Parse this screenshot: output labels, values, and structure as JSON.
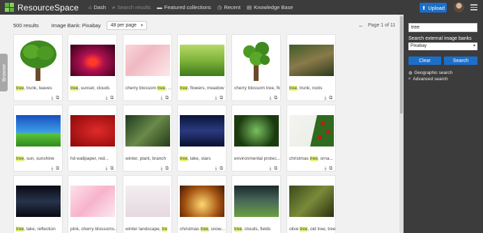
{
  "header": {
    "brand": "ResourceSpace",
    "nav": [
      {
        "icon": "home-icon",
        "glyph": "⌂",
        "label": "Dash",
        "muted": false
      },
      {
        "icon": "search-icon",
        "glyph": "⌕",
        "label": "Search results",
        "muted": true
      },
      {
        "icon": "folder-icon",
        "glyph": "▬",
        "label": "Featured collections",
        "muted": false
      },
      {
        "icon": "clock-icon",
        "glyph": "◷",
        "label": "Recent",
        "muted": false
      },
      {
        "icon": "book-icon",
        "glyph": "▤",
        "label": "Knowledge Base",
        "muted": false
      }
    ],
    "upload_label": "Upload"
  },
  "toolbar": {
    "results": "500 results",
    "bank": "Image Bank: Pixabay",
    "per_page": "48 per page",
    "pager": "Page 1 of 11"
  },
  "browse_tab": "Browse",
  "sidebar": {
    "search_value": "tree",
    "external_label": "Search external image banks",
    "external_selected": "Pixabay",
    "clear_label": "Clear",
    "search_label": "Search",
    "links": [
      {
        "icon": "globe-icon",
        "glyph": "◍",
        "label": "Geographic search"
      },
      {
        "icon": "magnifier-icon",
        "glyph": "⌕",
        "label": "Advanced search"
      }
    ]
  },
  "cards": [
    {
      "pre": "",
      "hl": "tree",
      "post": ", trunk, leaves",
      "bg": "linear-gradient(#fff,#fff)",
      "art": "tree1"
    },
    {
      "pre": "",
      "hl": "tree",
      "post": ", sunset, clouds",
      "bg": "radial-gradient(ellipse at 50% 55%, #ff3a2a 0 12%, #b01050 35%, #300018 100%)",
      "art": "none"
    },
    {
      "pre": "cherry blossom ",
      "hl": "tree",
      "post": ", ...",
      "bg": "linear-gradient(135deg,#f7d6da,#f1b9c2 40%,#fbe9ea)",
      "art": "none"
    },
    {
      "pre": "",
      "hl": "tree",
      "post": ", flowers, meadow",
      "bg": "linear-gradient(#b6d86a,#7fb33a 50%,#3f7a1e)",
      "art": "none"
    },
    {
      "pre": "cherry blossom tree, flow...",
      "hl": "",
      "post": "",
      "bg": "linear-gradient(#fff,#fff)",
      "art": "tree2"
    },
    {
      "pre": "",
      "hl": "tree",
      "post": ", trunk, roots",
      "bg": "linear-gradient(160deg,#3f5a2a,#8a7a4a 50%,#2b3a1c)",
      "art": "none"
    },
    {
      "pre": "",
      "hl": "tree",
      "post": ", sun, sunshine",
      "bg": "linear-gradient(#1a4ec0,#3aa0e8 55%,#5cc23a 60%,#2f8a1a)",
      "art": "none"
    },
    {
      "pre": "hd wallpaper, red...",
      "hl": "",
      "post": "",
      "bg": "radial-gradient(ellipse at 60% 50%, #e02a2a, #8a0808)",
      "art": "none"
    },
    {
      "pre": "winter, plant, branch",
      "hl": "",
      "post": "",
      "bg": "linear-gradient(135deg,#1e3a1e,#6a8a4a 50%,#243a18)",
      "art": "none"
    },
    {
      "pre": "",
      "hl": "tree",
      "post": ", lake, stars",
      "bg": "linear-gradient(#0a1438,#2a3a80 50%,#0a1030)",
      "art": "none"
    },
    {
      "pre": "environmental protec...",
      "hl": "",
      "post": "",
      "bg": "radial-gradient(circle at 50% 50%, #7ac060, #1a3a10 70%)",
      "art": "none"
    },
    {
      "pre": "christmas ",
      "hl": "tree",
      "post": ", orna...",
      "bg": "linear-gradient(135deg,#f4f4f0,#e8ece4)",
      "art": "xmas"
    },
    {
      "pre": "",
      "hl": "tree",
      "post": ", lake, reflection",
      "bg": "linear-gradient(#0a0a14,#26344a 50%,#0a0a14)",
      "art": "none"
    },
    {
      "pre": "pink, cherry blossoms...",
      "hl": "",
      "post": "",
      "bg": "linear-gradient(135deg,#fde0ea,#f7b3cc 50%,#fbe8f0)",
      "art": "none"
    },
    {
      "pre": "winter landscape, ",
      "hl": "tre",
      "post": "",
      "bg": "linear-gradient(#f4eef0,#e6d8e0)",
      "art": "none"
    },
    {
      "pre": "christmas ",
      "hl": "tree",
      "post": ", snow...",
      "bg": "radial-gradient(circle at 50% 60%, #ffd870, #a05010 60%, #401a04)",
      "art": "none"
    },
    {
      "pre": "",
      "hl": "tree",
      "post": ", clouds, fields",
      "bg": "linear-gradient(#1a2a2a,#4a6a5a 50%,#6aa040)",
      "art": "none"
    },
    {
      "pre": "olive ",
      "hl": "tree",
      "post": ", old tree, tree",
      "bg": "linear-gradient(135deg,#3a4a1a,#7a8a3a 50%,#2a3010)",
      "art": "none"
    }
  ],
  "colors": {
    "accent": "#1b6fc8",
    "header_bg": "#3c3c3c",
    "highlight": "#e6f07a"
  }
}
